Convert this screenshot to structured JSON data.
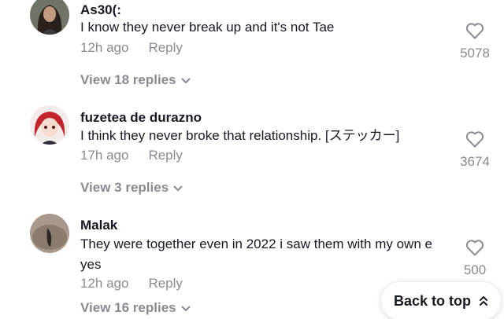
{
  "comments": [
    {
      "username": "As30(:",
      "text": "I know they never break up and it's not Tae",
      "time": "12h ago",
      "reply_label": "Reply",
      "likes": "5078",
      "view_replies": "View 18 replies",
      "avatar": "woman-dark-hair-avatar"
    },
    {
      "username": "fuzetea de durazno",
      "text": "I think they never broke that relationship. [ステッカー]",
      "time": "17h ago",
      "reply_label": "Reply",
      "likes": "3674",
      "view_replies": "View 3 replies",
      "avatar": "anime-red-hair-avatar"
    },
    {
      "username": "Malak",
      "text": "They were together even in 2022 i saw them with my own e yes",
      "time": "12h ago",
      "reply_label": "Reply",
      "likes": "500",
      "view_replies": "View 16 replies",
      "avatar": "blurred-photo-avatar"
    }
  ],
  "back_to_top": {
    "label": "Back to top",
    "icon": "double-chevron-up-icon"
  },
  "colors": {
    "text": "#161823",
    "muted": "#8a8b91",
    "background": "#ffffff"
  }
}
